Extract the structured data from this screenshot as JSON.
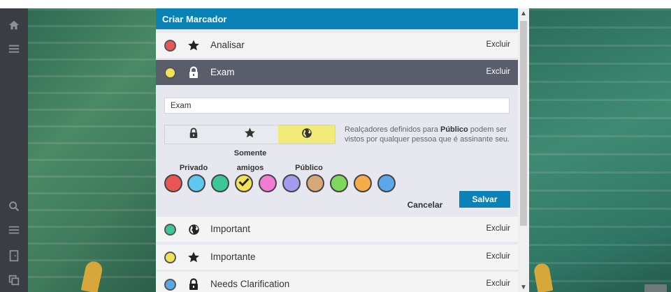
{
  "panel": {
    "title": "Criar Marcador"
  },
  "markers": [
    {
      "label": "Analisar",
      "color": "#e95454",
      "visibility": "star-icon",
      "delete_label": "Excluir"
    },
    {
      "label": "Exam",
      "color": "#f2e25a",
      "visibility": "lock-icon",
      "delete_label": "Excluir",
      "active": true
    },
    {
      "label": "Important",
      "color": "#3cc796",
      "visibility": "globe-icon",
      "delete_label": "Excluir"
    },
    {
      "label": "Importante",
      "color": "#f2e25a",
      "visibility": "star-icon",
      "delete_label": "Excluir"
    },
    {
      "label": "Needs Clarification",
      "color": "#5aa8ea",
      "visibility": "lock-icon",
      "delete_label": "Excluir"
    }
  ],
  "editor": {
    "name_value": "Exam",
    "visibility_options": [
      {
        "caption": "Privado",
        "icon": "lock-icon"
      },
      {
        "caption_line1": "Somente",
        "caption_line2": "amigos",
        "icon": "star-icon"
      },
      {
        "caption": "Público",
        "icon": "globe-icon",
        "selected": true
      }
    ],
    "help_prefix": "Realçadores definidos para ",
    "help_bold": "Público",
    "help_suffix": " podem ser vistos por qualquer pessoa que é assinante seu.",
    "colors": [
      "#e95454",
      "#5ec8ef",
      "#3cc796",
      "#f2e25a",
      "#f27bd3",
      "#a59aec",
      "#d7a777",
      "#7ed85e",
      "#f5ad4a",
      "#5aa8ea"
    ],
    "selected_color_index": 3,
    "cancel_label": "Cancelar",
    "save_label": "Salvar"
  },
  "colors": {
    "accent": "#0a82b5",
    "active_row": "#5a5d6a",
    "selected_segment": "#f2ea78"
  }
}
